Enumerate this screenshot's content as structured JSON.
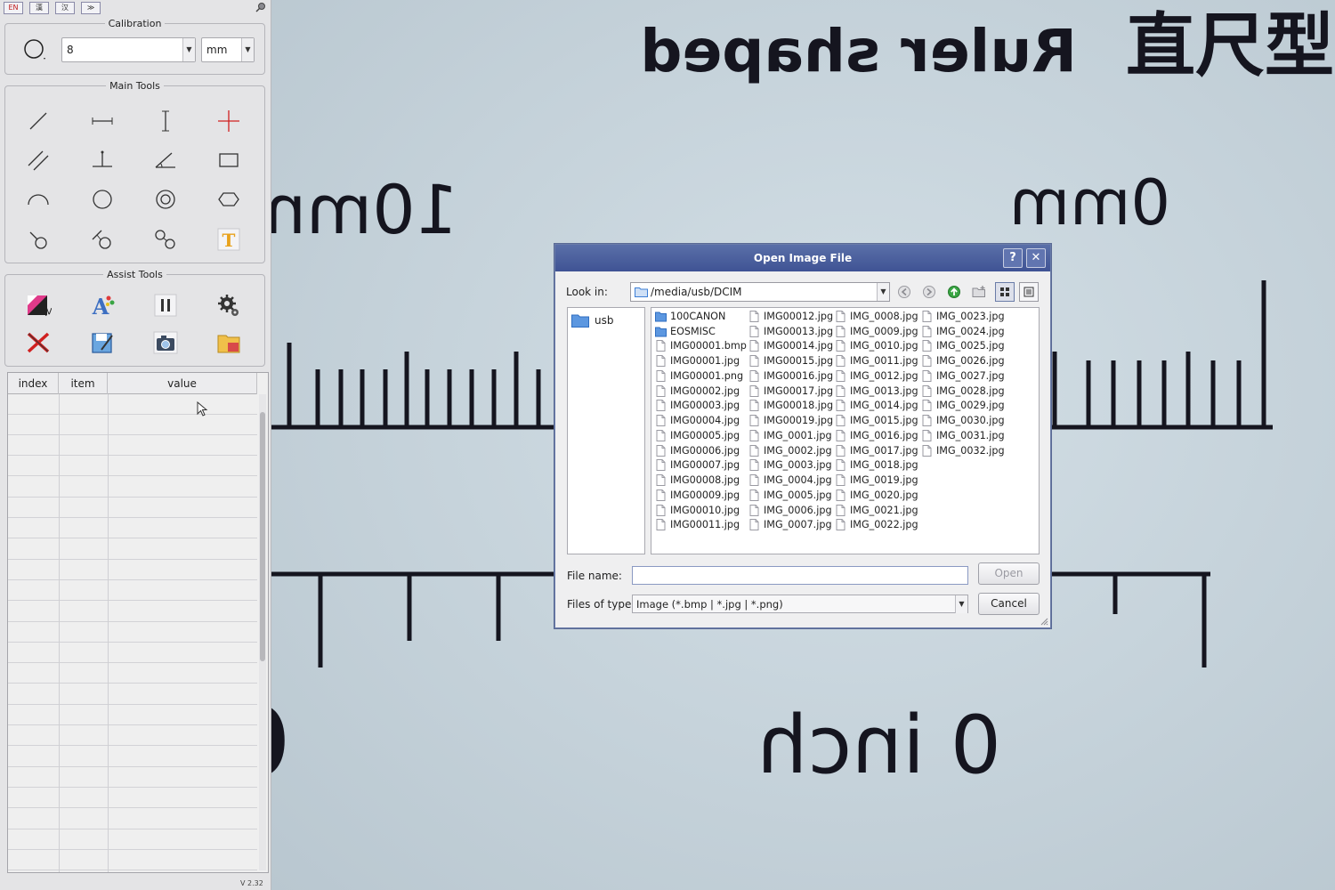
{
  "lang_bar": {
    "buttons": [
      "EN",
      "漢",
      "汉",
      "≫"
    ]
  },
  "calibration": {
    "title": "Calibration",
    "value": "8",
    "unit": "mm"
  },
  "main_tools": {
    "title": "Main Tools",
    "icons": [
      "line-tool-icon",
      "horizontal-line-tool-icon",
      "vertical-line-tool-icon",
      "crosshair-tool-icon",
      "parallel-lines-tool-icon",
      "perpendicular-tool-icon",
      "angle-tool-icon",
      "rectangle-tool-icon",
      "arc-tool-icon",
      "circle-tool-icon",
      "concentric-circles-tool-icon",
      "ellipse-tool-icon",
      "point-to-circle-tool-icon",
      "line-to-circle-tool-icon",
      "two-circles-tool-icon",
      "text-tool-icon"
    ],
    "text_icon_label": "T"
  },
  "assist_tools": {
    "title": "Assist Tools",
    "icons": [
      "color-tool-icon",
      "font-tool-icon",
      "pause-icon",
      "settings-gear-icon",
      "delete-icon",
      "save-icon",
      "camera-icon",
      "open-folder-icon"
    ],
    "font_icon_label": "A"
  },
  "table": {
    "columns": [
      "index",
      "item",
      "value"
    ],
    "row_count": 23
  },
  "version": "V 2.32",
  "background": {
    "top_text": "Ruler shaped",
    "top_cjk": "直尺型",
    "mm_left": "10mm",
    "mm_right": "0mm",
    "inch_left": "0.",
    "inch_right": "0 inch"
  },
  "dialog": {
    "title": "Open Image File",
    "help_label": "?",
    "close_label": "✕",
    "look_in_label": "Look in:",
    "path": "/media/usb/DCIM",
    "sidebar": [
      "usb"
    ],
    "files": [
      [
        "100CANON",
        "EOSMISC",
        "IMG00001.bmp",
        "IMG00001.jpg",
        "IMG00001.png",
        "IMG00002.jpg",
        "IMG00003.jpg",
        "IMG00004.jpg",
        "IMG00005.jpg",
        "IMG00006.jpg",
        "IMG00007.jpg",
        "IMG00008.jpg",
        "IMG00009.jpg",
        "IMG00010.jpg",
        "IMG00011.jpg"
      ],
      [
        "IMG00012.jpg",
        "IMG00013.jpg",
        "IMG00014.jpg",
        "IMG00015.jpg",
        "IMG00016.jpg",
        "IMG00017.jpg",
        "IMG00018.jpg",
        "IMG00019.jpg",
        "IMG_0001.jpg",
        "IMG_0002.jpg",
        "IMG_0003.jpg",
        "IMG_0004.jpg",
        "IMG_0005.jpg",
        "IMG_0006.jpg",
        "IMG_0007.jpg"
      ],
      [
        "IMG_0008.jpg",
        "IMG_0009.jpg",
        "IMG_0010.jpg",
        "IMG_0011.jpg",
        "IMG_0012.jpg",
        "IMG_0013.jpg",
        "IMG_0014.jpg",
        "IMG_0015.jpg",
        "IMG_0016.jpg",
        "IMG_0017.jpg",
        "IMG_0018.jpg",
        "IMG_0019.jpg",
        "IMG_0020.jpg",
        "IMG_0021.jpg",
        "IMG_0022.jpg"
      ],
      [
        "IMG_0023.jpg",
        "IMG_0024.jpg",
        "IMG_0025.jpg",
        "IMG_0026.jpg",
        "IMG_0027.jpg",
        "IMG_0028.jpg",
        "IMG_0029.jpg",
        "IMG_0030.jpg",
        "IMG_0031.jpg",
        "IMG_0032.jpg"
      ]
    ],
    "folders": [
      "100CANON",
      "EOSMISC"
    ],
    "file_name_label": "File name:",
    "file_name_value": "",
    "files_of_type_label": "Files of type:",
    "files_of_type_value": "Image (*.bmp | *.jpg | *.png)",
    "open_label": "Open",
    "cancel_label": "Cancel"
  },
  "colors": {
    "dialog_title": "#4a5e9e",
    "folder_blue": "#3d7fd6",
    "ruler_ink": "#14141e"
  }
}
